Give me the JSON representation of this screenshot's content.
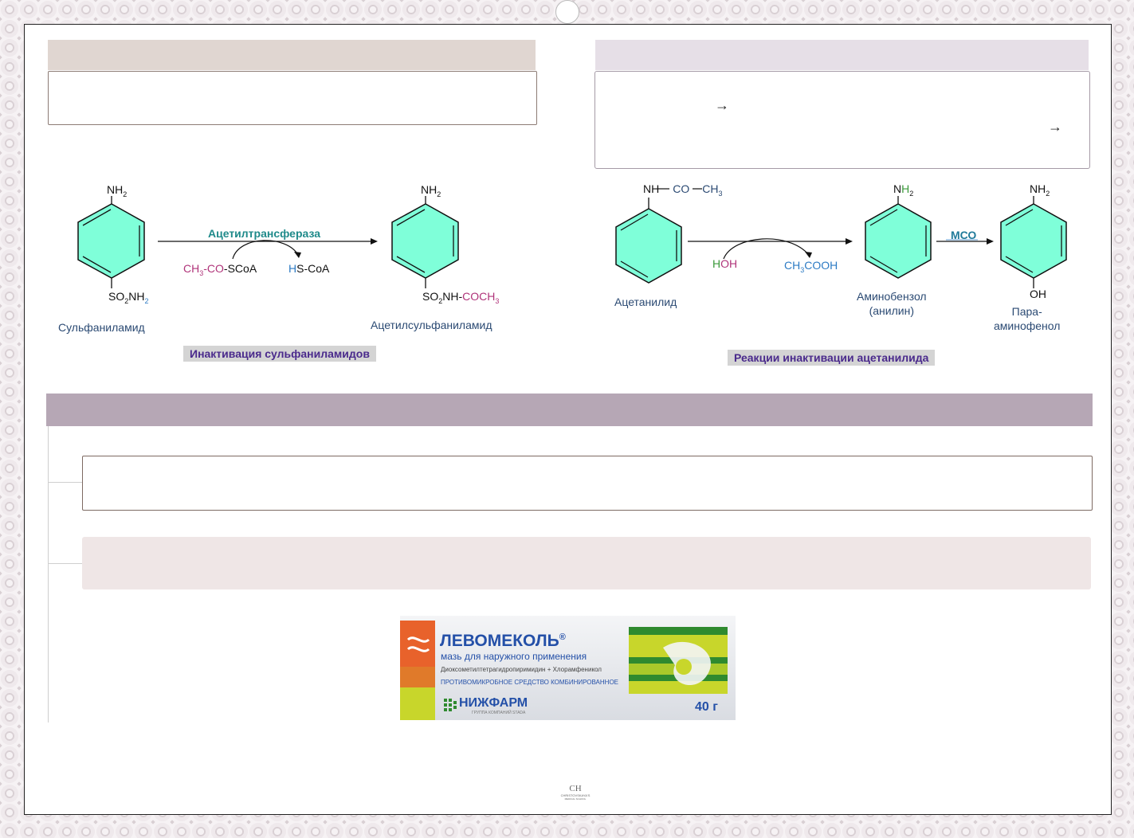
{
  "left_scheme": {
    "start_top_group": "NH",
    "start_top_sub": "2",
    "start_bottom_group": "SO",
    "start_bottom_sub1": "2",
    "start_bottom_mid": "NH",
    "start_bottom_sub2": "2",
    "start_name": "Сульфаниламид",
    "enzyme": "Ацетилтрансфераза",
    "reagent_in_a": "CH",
    "reagent_in_sub": "3",
    "reagent_in_b": "-CO",
    "reagent_in_c": "-SCoA",
    "reagent_out_h": "H",
    "reagent_out_rest": "S-CoA",
    "product_top_group": "NH",
    "product_top_sub": "2",
    "product_bottom_a": "SO",
    "product_bottom_sub1": "2",
    "product_bottom_b": "NH-",
    "product_bottom_c": "COCH",
    "product_bottom_sub2": "3",
    "product_name": "Ацетилсульфаниламид",
    "caption": "Инактивация сульфаниламидов"
  },
  "right_scheme": {
    "start_top_a": "NH",
    "start_top_b": "CO",
    "start_top_c": "CH",
    "start_top_sub": "3",
    "start_name": "Ацетанилид",
    "reagent_in_h": "H",
    "reagent_in_oh": "OH",
    "reagent_out_a": "CH",
    "reagent_out_sub": "3",
    "reagent_out_b": "COOH",
    "mid_top_n": "N",
    "mid_top_h": "H",
    "mid_top_sub": "2",
    "mid_name_line1": "Аминобензол",
    "mid_name_line2": "(анилин)",
    "enzyme": "МСО",
    "end_top": "NH",
    "end_top_sub": "2",
    "end_bottom": "OH",
    "end_name_line1": "Пара-",
    "end_name_line2": "аминофенол",
    "caption": "Реакции инактивации ацетанилида"
  },
  "box_right": {
    "arrow1": "→",
    "arrow2": "→"
  },
  "package": {
    "brand": "ЛЕВОМЕКОЛЬ",
    "reg": "®",
    "line1": "мазь для наружного применения",
    "line2": "Диоксометилтетрагидропиримидин + Хлорамфеникол",
    "line3": "ПРОТИВОМИКРОБНОЕ СРЕДСТВО КОМБИНИРОВАННОЕ",
    "maker": "НИЖФАРМ",
    "maker_sub": "ГРУППА КОМПАНИЙ STADA",
    "weight": "40 г",
    "colors": {
      "orange": "#e8622b",
      "yellow_green": "#c8d62b",
      "green": "#2f8a2f",
      "blue": "#2450a8",
      "silver": "#e4e6ea"
    }
  },
  "logo": {
    "mark": "CH",
    "line1": "CHRISTOVSKAYA'S",
    "line2": "MEDICAL SCHOOL"
  },
  "colors": {
    "ring_fill": "#7fffd9",
    "band_left": "#e0d6d1",
    "band_right": "#e6dfe7",
    "band_wide": "#b6a7b5",
    "box_pink": "#efe6e6",
    "caption_text": "#4a2a8c"
  }
}
